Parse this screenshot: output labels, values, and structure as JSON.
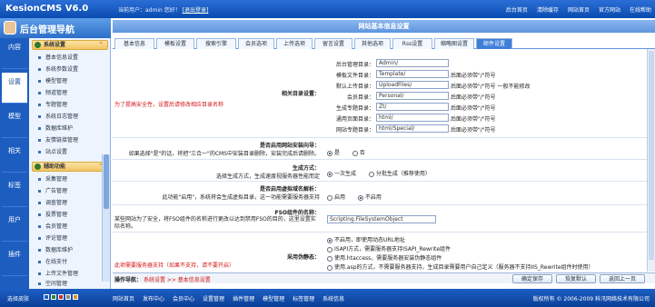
{
  "header": {
    "app_title": "KesionCMS V6.0",
    "info_prefix": "当前用户：admin 您好！",
    "info_link": "[退出登录]",
    "links": [
      "后台首页",
      "清除缓存",
      "网站首页",
      "官方网站",
      "在线帮助"
    ]
  },
  "sidebar": {
    "title": "后台管理导航",
    "vtabs": [
      "内容",
      "设置",
      "模型",
      "相关",
      "标签",
      "用户",
      "插件"
    ],
    "active_vtab": 1,
    "groups": [
      {
        "label": "系统设置",
        "items": [
          "基本信息设置",
          "系统参数设置",
          "模型管理",
          "频道管理",
          "专题管理",
          "系统日志管理",
          "数据库维护",
          "友情链接管理",
          "站点设置"
        ]
      },
      {
        "label": "辅助功能",
        "items": [
          "采集管理",
          "广告管理",
          "调查管理",
          "投票管理",
          "会员管理",
          "评论管理",
          "数据库维护",
          "在线支付",
          "上传文件管理",
          "空间管理"
        ]
      }
    ]
  },
  "main": {
    "title": "网站基本信息设置",
    "tabs": [
      "基本信息",
      "模板设置",
      "搜索引擎",
      "会员选项",
      "上传选项",
      "留言设置",
      "其他选项",
      "Rss设置",
      "缩略图设置",
      "邮件设置"
    ],
    "active_tab": 9,
    "dir_section": {
      "label": "相关目录设置：",
      "note": "为了提高安全性，设置后请修改相应目录名称",
      "fields": [
        {
          "label": "后台管理目录：",
          "value": "Admin/",
          "hint": ""
        },
        {
          "label": "模板文件目录：",
          "value": "Template/",
          "hint": "后面必须带\"/\"符号"
        },
        {
          "label": "默认上传目录：",
          "value": "UploadFiles/",
          "hint": "后面必须带\"/\"符号 一般不能修改"
        },
        {
          "label": "会员目录：",
          "value": "Personal/",
          "hint": "后面必须带\"/\"符号"
        },
        {
          "label": "生成专题目录：",
          "value": "Zt/",
          "hint": "后面必须带\"/\"符号"
        },
        {
          "label": "通用页面目录：",
          "value": "html/",
          "hint": "后面必须带\"/\"符号"
        },
        {
          "label": "网站专题目录：",
          "value": "html/Special/",
          "hint": "后面必须带\"/\"符号"
        }
      ]
    },
    "ask_section": {
      "label": "是否启用网站安装向导：",
      "desc": "如果选择\"是\"的话，将把\"三合一\"的CMS中安装目录删除，安装完成后请删除。",
      "yes": "是",
      "no": "否"
    },
    "process_section": {
      "label": "生成方式：",
      "desc": "选择生成方式，生成速度视服务器性能而定",
      "opt1": "一次生成",
      "opt2": "分批生成（推荐使用）"
    },
    "virtual_section": {
      "label": "是否启用虚拟域名解析：",
      "desc": "此功能\"启用\"，系统将会生成虚拟目录，这一功能需要服务器支持",
      "opt1": "启用",
      "opt2": "不启用"
    },
    "fso_section": {
      "label": "FSO组件的名称：",
      "desc": "某些网站为了安全，将FSO组件的名称进行更改以达到禁用FSO的目的，这里设置实际名称。",
      "value": "Scripting.FileSystemObject"
    },
    "rewrite_section": {
      "label": "采用伪静态：",
      "note": "此项需要服务器支持（如果不支持，请不要开启）",
      "opts": [
        "不启用，即使用动态URL地址",
        "ISAPI方式，需要服务器支持ISAPI_Rewrite组件",
        "使用.htaccess，需要服务器安装伪静态组件",
        "使用.asp的方式，不需要服务器支持，生成目录需要用户自己定义（服务器不支持IIS_Rewrite组件时使用）"
      ]
    }
  },
  "opbar": {
    "nav_label": "操作导航：",
    "nav_path": "系统设置 >> 基本信息设置",
    "buttons": [
      "确定保存",
      "恢复默认",
      "返回上一页"
    ]
  },
  "footer": {
    "left": "选择皮肤",
    "menu": [
      "网站首页",
      "发布中心",
      "会员中心",
      "设置管理",
      "插件管理",
      "模型管理",
      "标签管理",
      "系统信息"
    ],
    "right": "版权所有 © 2006-2009 科汛网络技术有限公司",
    "skin_colors": [
      "#1d5dbf",
      "#2a8a2a",
      "#c03030",
      "#888888",
      "#e09020"
    ]
  }
}
